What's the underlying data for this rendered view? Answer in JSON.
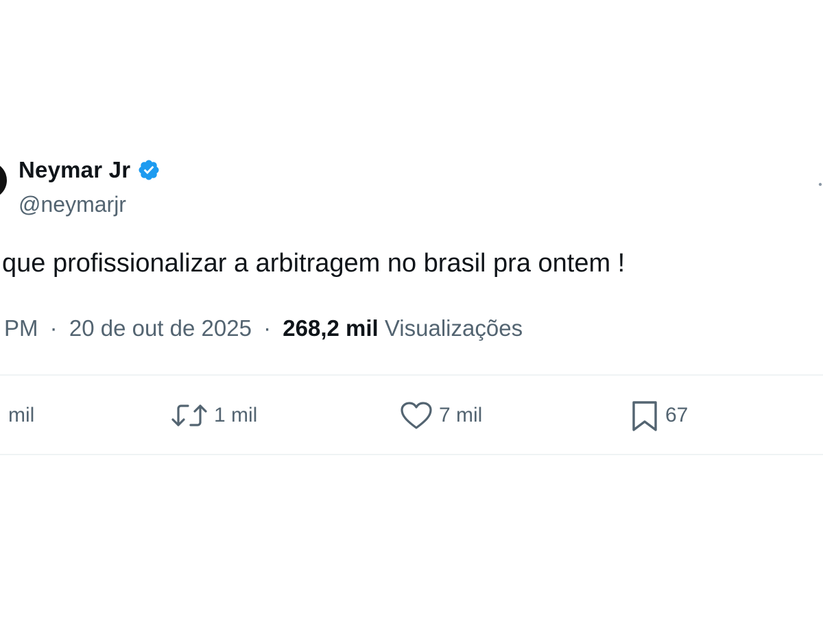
{
  "tweet": {
    "author": {
      "name": "Neymar Jr",
      "handle": "@neymarjr",
      "verified": true
    },
    "text": "que profissionalizar a arbitragem no brasil pra ontem !",
    "meta": {
      "time": "PM",
      "separator": "·",
      "date": "20 de out de 2025",
      "views_count": "268,2 mil",
      "views_label": "Visualizações"
    },
    "actions": {
      "replies": "mil",
      "retweets": "1 mil",
      "likes": "7 mil",
      "bookmarks": "67"
    }
  },
  "colors": {
    "text_primary": "#0f1419",
    "text_secondary": "#536471",
    "verified_badge": "#1d9bf0",
    "divider": "#eff3f4"
  },
  "icons": {
    "verified": "verified-badge-icon",
    "retweet": "retweet-icon",
    "like": "heart-icon",
    "bookmark": "bookmark-icon",
    "more": "more-icon"
  }
}
